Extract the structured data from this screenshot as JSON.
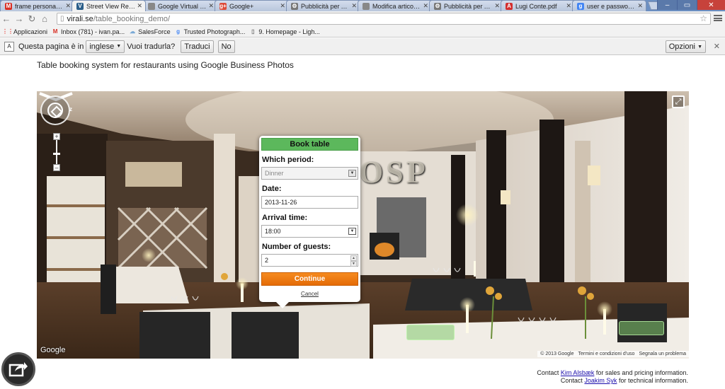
{
  "browser": {
    "tabs": [
      {
        "title": "frame personalizzat",
        "icon": "gmail-icon",
        "color": "#d93025",
        "glyph": "M",
        "active": false
      },
      {
        "title": "Street View Restaura",
        "icon": "virali-icon",
        "color": "#2c5f8a",
        "glyph": "V",
        "active": true
      },
      {
        "title": "Google Virtual Tour",
        "icon": "page-icon",
        "color": "#888888",
        "glyph": "",
        "active": false
      },
      {
        "title": "Google+",
        "icon": "google-plus-icon",
        "color": "#dd4b39",
        "glyph": "g+",
        "active": false
      },
      {
        "title": "Pubblicità per Azien",
        "icon": "gear-icon",
        "color": "#777777",
        "glyph": "⚙",
        "active": false
      },
      {
        "title": "Modifica articolo ‹",
        "icon": "page-icon",
        "color": "#888888",
        "glyph": "",
        "active": false
      },
      {
        "title": "Pubblicità per Azien",
        "icon": "gear-icon",
        "color": "#777777",
        "glyph": "⚙",
        "active": false
      },
      {
        "title": "Lugi Conte.pdf",
        "icon": "pdf-icon",
        "color": "#d32f2f",
        "glyph": "A",
        "active": false
      },
      {
        "title": "user e password ubu",
        "icon": "google-icon",
        "color": "#4285f4",
        "glyph": "g",
        "active": false
      }
    ],
    "url_domain": "virali.se",
    "url_path": "/table_booking_demo/",
    "bookmarks": [
      {
        "label": "Applicazioni",
        "icon": "apps-icon"
      },
      {
        "label": "Inbox (781) - ivan.pa...",
        "icon": "gmail-icon"
      },
      {
        "label": "SalesForce",
        "icon": "cloud-icon"
      },
      {
        "label": "Trusted Photograph...",
        "icon": "google-icon"
      },
      {
        "label": "9. Homepage - Ligh...",
        "icon": "page-icon"
      }
    ]
  },
  "translate": {
    "prefix": "Questa pagina è in",
    "language": "inglese",
    "question": "Vuoi tradurla?",
    "translate_btn": "Traduci",
    "no_btn": "No",
    "options_btn": "Opzioni"
  },
  "page": {
    "headline": "Table booking system for restaurants using Google Business Photos"
  },
  "panorama": {
    "google_logo": "Google",
    "copyright": "© 2013 Google",
    "terms": "Termini e condizioni d'uso",
    "report": "Segnala un problema",
    "wall_text": "OSP"
  },
  "booking": {
    "title": "Book table",
    "period_label": "Which period:",
    "period_value": "Dinner",
    "date_label": "Date:",
    "date_value": "2013-11-26",
    "arrival_label": "Arrival time:",
    "arrival_value": "18:00",
    "guests_label": "Number of guests:",
    "guests_value": "2",
    "continue_label": "Continue",
    "cancel_label": "Cancel"
  },
  "footer": {
    "line1_prefix": "Contact",
    "line1_name": "Kim Alsbæk",
    "line1_suffix": "for sales and pricing information.",
    "line2_prefix": "Contact",
    "line2_name": "Joakim Syk",
    "line2_suffix": "for technical information."
  }
}
